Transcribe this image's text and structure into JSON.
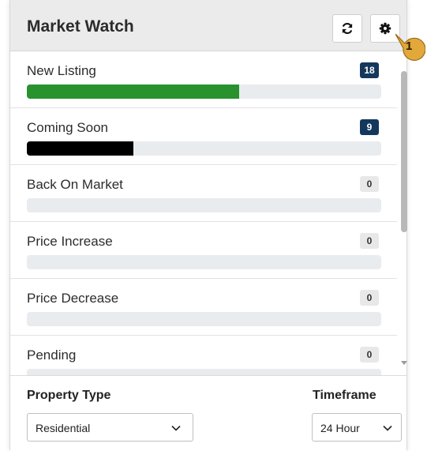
{
  "header": {
    "title": "Market Watch"
  },
  "items": [
    {
      "label": "New Listing",
      "count": "18",
      "progress": 0.6,
      "color": "#27922e",
      "active": true
    },
    {
      "label": "Coming Soon",
      "count": "9",
      "progress": 0.3,
      "color": "#000000",
      "active": true
    },
    {
      "label": "Back On Market",
      "count": "0",
      "progress": 0,
      "color": "#e9ecef",
      "active": false
    },
    {
      "label": "Price Increase",
      "count": "0",
      "progress": 0,
      "color": "#e9ecef",
      "active": false
    },
    {
      "label": "Price Decrease",
      "count": "0",
      "progress": 0,
      "color": "#e9ecef",
      "active": false
    },
    {
      "label": "Pending",
      "count": "0",
      "progress": 0,
      "color": "#e9ecef",
      "active": false
    }
  ],
  "footer": {
    "property_type_label": "Property Type",
    "property_type_value": "Residential",
    "timeframe_label": "Timeframe",
    "timeframe_value": "24 Hour"
  },
  "callout": {
    "number": "1",
    "color": "#e2a83a"
  }
}
